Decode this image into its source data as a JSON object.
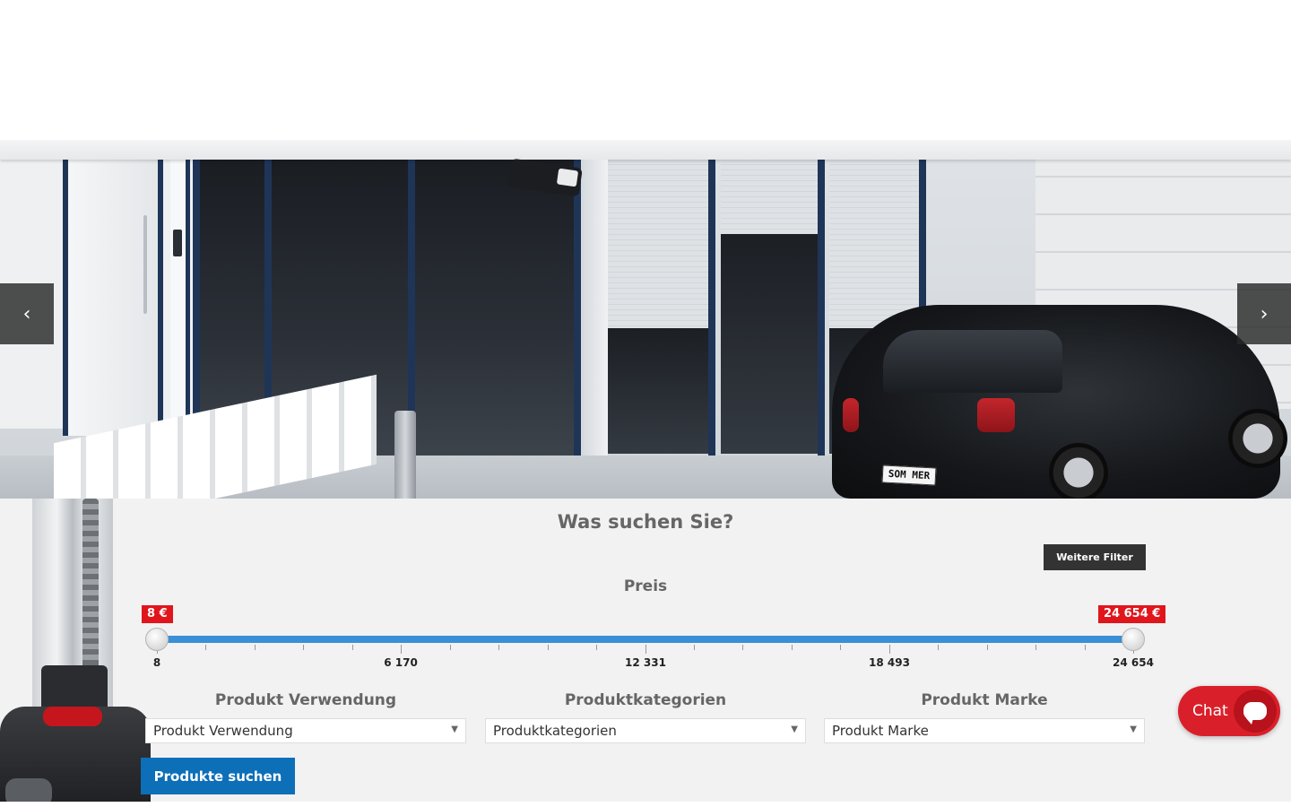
{
  "hero": {
    "license_plate": "SOM MER",
    "prev_icon": "chevron-left-icon",
    "next_icon": "chevron-right-icon"
  },
  "search": {
    "title": "Was suchen Sie?",
    "more_filters_label": "Weitere Filter",
    "price_label": "Preis",
    "price_min_badge": "8 €",
    "price_max_badge": "24 654 €",
    "price_min": 8,
    "price_max": 24654,
    "tick_labels": [
      "8",
      "6 170",
      "12 331",
      "18 493",
      "24 654"
    ],
    "filters": [
      {
        "label": "Produkt Verwendung",
        "selected": "Produkt Verwendung"
      },
      {
        "label": "Produktkategorien",
        "selected": "Produktkategorien"
      },
      {
        "label": "Produkt Marke",
        "selected": "Produkt Marke"
      }
    ],
    "submit_label": "Produkte suchen"
  },
  "chat": {
    "label": "Chat",
    "icon": "chat-bubble-icon"
  },
  "colors": {
    "accent_red": "#e0161c",
    "slider_blue": "#3a8fd6",
    "button_blue": "#0d6fb8",
    "chat_red": "#d9202a",
    "panel_bg": "#f2f2f2"
  }
}
